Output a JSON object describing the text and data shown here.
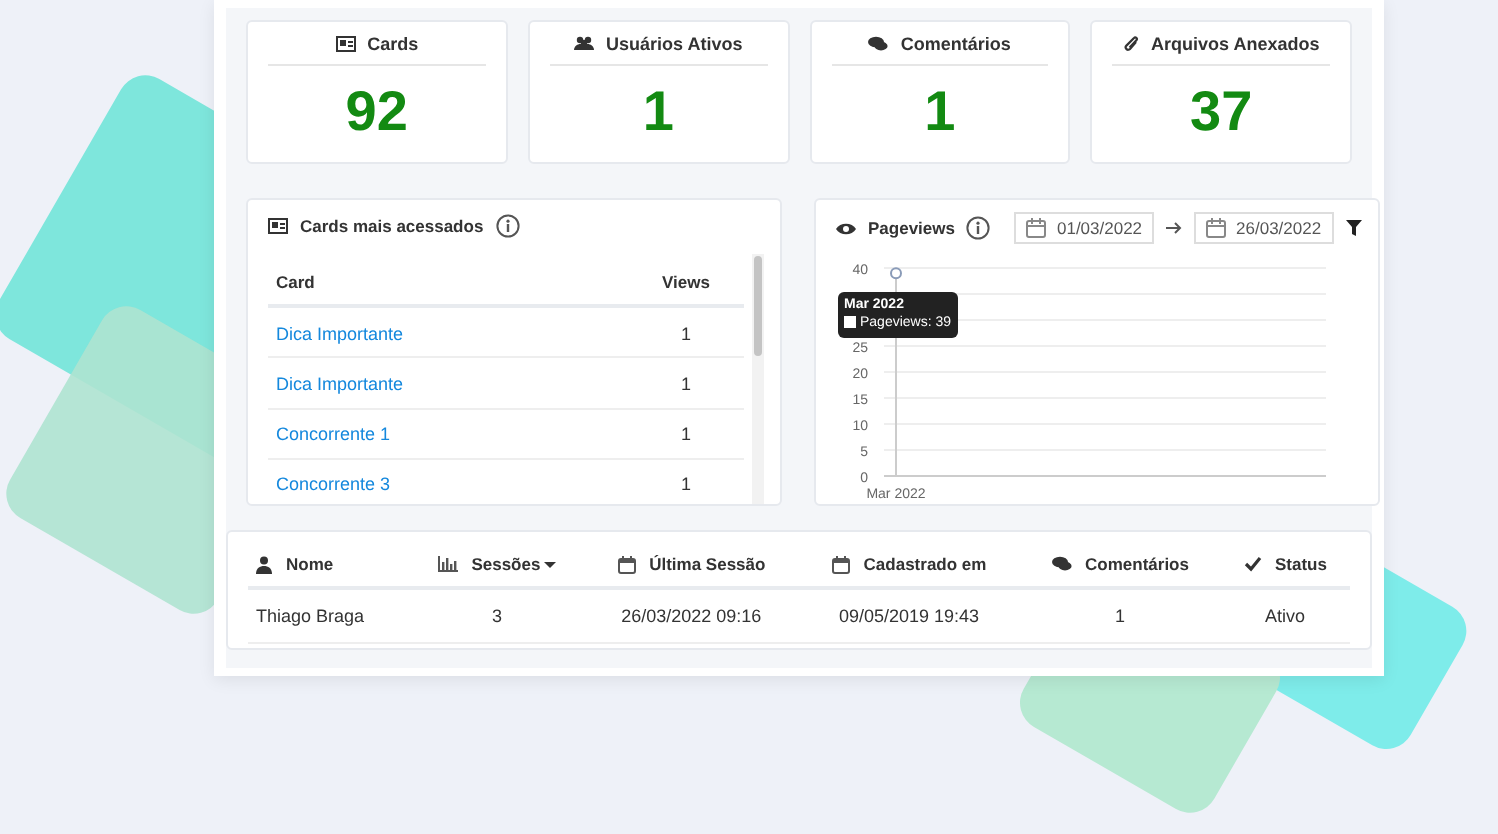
{
  "stats": [
    {
      "label": "Cards",
      "value": "92"
    },
    {
      "label": "Usuários Ativos",
      "value": "1"
    },
    {
      "label": "Comentários",
      "value": "1"
    },
    {
      "label": "Arquivos Anexados",
      "value": "37"
    }
  ],
  "top_cards": {
    "title": "Cards mais acessados",
    "columns": [
      "Card",
      "Views"
    ],
    "rows": [
      {
        "card": "Dica Importante",
        "views": "1"
      },
      {
        "card": "Dica Importante",
        "views": "1"
      },
      {
        "card": "Concorrente 1",
        "views": "1"
      },
      {
        "card": "Concorrente 3",
        "views": "1"
      }
    ]
  },
  "pageviews": {
    "title": "Pageviews",
    "date_from": "01/03/2022",
    "date_to": "26/03/2022",
    "tooltip": {
      "title": "Mar 2022",
      "text": "Pageviews: 39"
    },
    "chart_data": {
      "type": "line",
      "grid": true,
      "categories": [
        "Mar 2022"
      ],
      "series": [
        {
          "color": "#8a9bb8",
          "marker": "circle",
          "values": [
            39
          ]
        }
      ],
      "ylim": [
        0,
        40
      ],
      "yticks": [
        0,
        5,
        10,
        15,
        20,
        25,
        40
      ]
    }
  },
  "users_table": {
    "columns": [
      {
        "label": "Nome",
        "sorted": false
      },
      {
        "label": "Sessões",
        "sorted": true
      },
      {
        "label": "Última Sessão",
        "sorted": false
      },
      {
        "label": "Cadastrado em",
        "sorted": false
      },
      {
        "label": "Comentários",
        "sorted": false
      },
      {
        "label": "Status",
        "sorted": false
      }
    ],
    "rows": [
      {
        "cells": [
          "Thiago Braga",
          "3",
          "26/03/2022 09:16",
          "09/05/2019 19:43",
          "1",
          "Ativo"
        ]
      }
    ]
  }
}
